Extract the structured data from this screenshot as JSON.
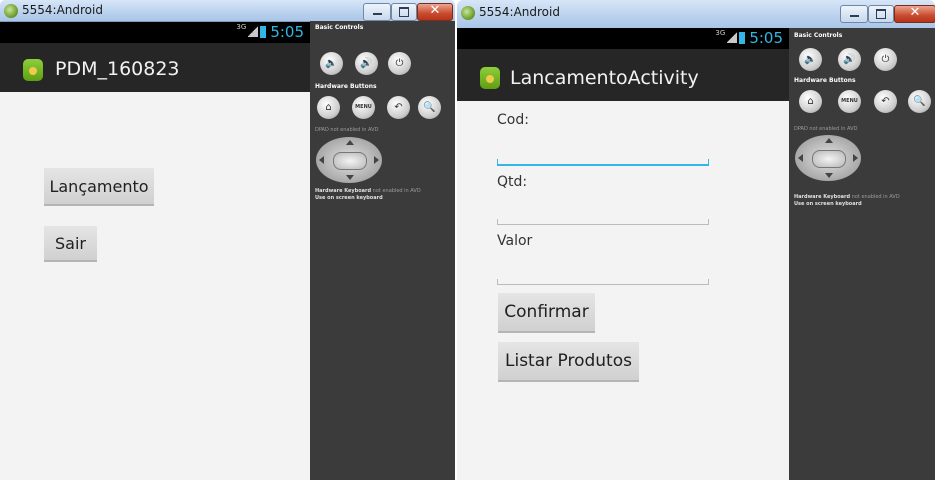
{
  "windows": [
    {
      "title": "5554:Android",
      "status": {
        "network": "3G",
        "time": "5:05"
      },
      "app_title": "PDM_160823",
      "buttons": [
        "Lançamento",
        "Sair"
      ],
      "controls": {
        "basic_controls_heading": "Basic Controls",
        "hardware_buttons_heading": "Hardware Buttons",
        "menu_label": "MENU",
        "dpad_note": "DPAD not enabled in AVD",
        "keyboard_note_strong": "Hardware Keyboard",
        "keyboard_note_rest": " not enabled in AVD",
        "keyboard_note_line2": "Use on screen keyboard"
      }
    },
    {
      "title": "5554:Android",
      "status": {
        "network": "3G",
        "time": "5:05"
      },
      "app_title": "LancamentoActivity",
      "fields": [
        {
          "label": "Cod:",
          "value": ""
        },
        {
          "label": "Qtd:",
          "value": ""
        },
        {
          "label": "Valor",
          "value": ""
        }
      ],
      "buttons": [
        "Confirmar",
        "Listar Produtos"
      ],
      "controls": {
        "basic_controls_heading": "Basic Controls",
        "hardware_buttons_heading": "Hardware Buttons",
        "menu_label": "MENU",
        "dpad_note": "DPAD not enabled in AVD",
        "keyboard_note_strong": "Hardware Keyboard",
        "keyboard_note_rest": " not enabled in AVD",
        "keyboard_note_line2": "Use on screen keyboard"
      }
    }
  ],
  "colors": {
    "holo_blue": "#33b5e5",
    "action_bar": "#262626",
    "controls_panel": "#3b3b3b",
    "close_red": "#c84a2d"
  }
}
